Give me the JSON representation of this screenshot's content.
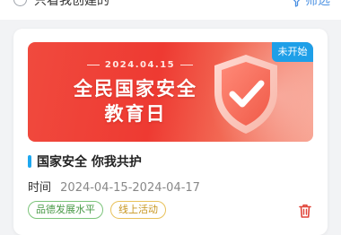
{
  "filter": {
    "only_mine_label": "只看我创建的",
    "filter_button_label": "筛选"
  },
  "card": {
    "banner": {
      "date": "2024.04.15",
      "title_line1": "全民国家安全",
      "title_line2": "教育日",
      "status": "未开始"
    },
    "title": "国家安全 你我共护",
    "time_label": "时间",
    "time_value": "2024-04-15-2024-04-17",
    "tags": [
      "品德发展水平",
      "线上活动"
    ],
    "accent_color": "#1ea8f0",
    "status_color": "#1e9fe8",
    "delete_icon": "trash-icon"
  }
}
